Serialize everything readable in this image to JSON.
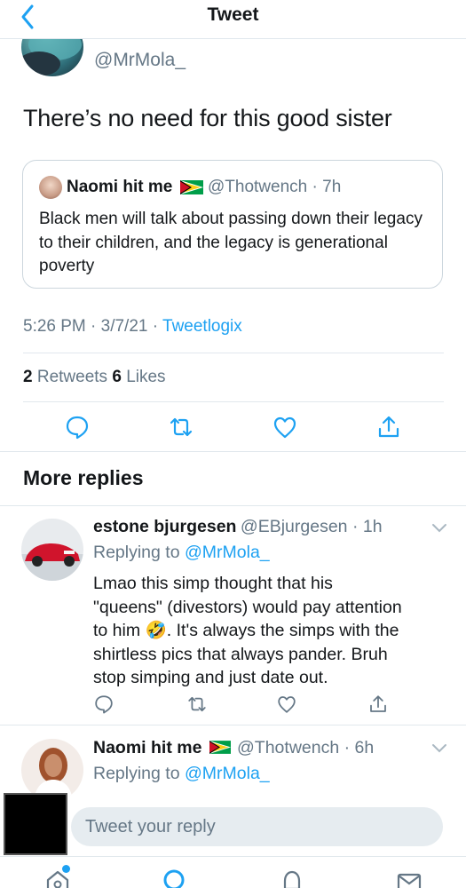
{
  "header": {
    "title": "Tweet"
  },
  "main_tweet": {
    "handle": "@MrMola_",
    "text": "There’s no need for this good sister",
    "quote": {
      "name": "Naomi hit me",
      "handle": "@Thotwench",
      "separator": "·",
      "time": "7h",
      "text": "Black men will talk about passing down their legacy to their children, and the legacy is generational poverty"
    },
    "timestamp": "5:26 PM · 3/7/21 · ",
    "source": "Tweetlogix",
    "retweets_count": "2",
    "retweets_label": " Retweets ",
    "likes_count": "6",
    "likes_label": " Likes"
  },
  "more_replies": {
    "title": "More replies"
  },
  "replies": [
    {
      "name": "estone bjurgesen",
      "handle": "@EBjurgesen",
      "meta_sep": " · ",
      "time": "1h",
      "replying_prefix": "Replying to ",
      "replying_to": "@MrMola_",
      "text_lines": [
        "Lmao this simp thought that his",
        "\"queens\" (divestors) would pay attention",
        "to him 🤣.  It's always the simps with the",
        "shirtless pics that always pander. Bruh",
        "stop simping and just date out."
      ]
    },
    {
      "name": "Naomi hit me",
      "handle": "@Thotwench",
      "meta_sep": " · ",
      "time": "6h",
      "replying_prefix": "Replying to ",
      "replying_to": "@MrMola_"
    }
  ],
  "composer": {
    "placeholder": "Tweet your reply"
  },
  "colors": {
    "accent": "#1da1f2",
    "text": "#14171a",
    "muted": "#657786",
    "border": "#e1e8ed",
    "like": "#657786"
  },
  "icons": {
    "back": "chevron-left-icon",
    "reply": "reply-bubble-icon",
    "retweet": "retweet-icon",
    "like": "heart-icon",
    "share": "share-icon",
    "home": "home-icon",
    "search": "search-icon",
    "notifications": "bell-icon",
    "messages": "mail-icon",
    "flag": "guyana-flag-icon",
    "more": "chevron-down-icon"
  }
}
